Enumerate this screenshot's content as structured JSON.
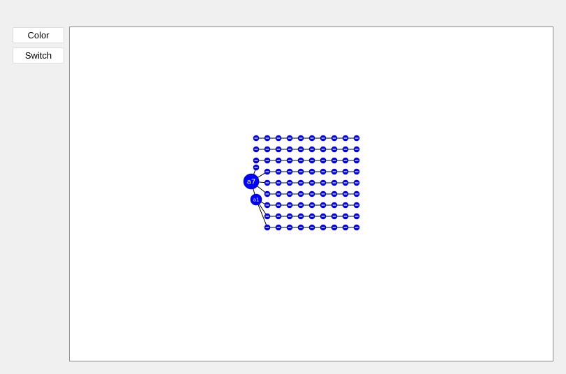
{
  "toolbar": {
    "color_label": "Color",
    "switch_label": "Switch"
  },
  "graph": {
    "node_color": "#0000ff",
    "edge_color": "#000000",
    "background_color": "#ffffff",
    "highlighted_nodes": [
      "a7",
      "a1"
    ]
  }
}
